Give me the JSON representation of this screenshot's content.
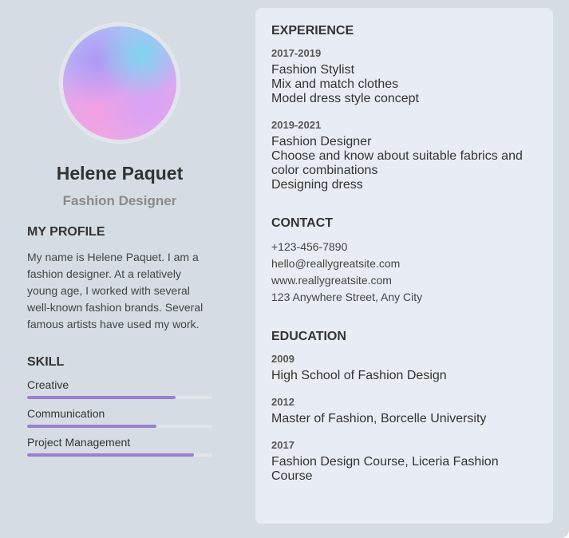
{
  "profile": {
    "name": "Helene Paquet",
    "role": "Fashion Designer"
  },
  "my_profile": {
    "title": "MY PROFILE",
    "text": "My name is Helene Paquet. I am a fashion designer. At a relatively young age, I worked with several well-known fashion brands. Several famous artists have used my work."
  },
  "skills": {
    "title": "SKILL",
    "items": [
      {
        "label": "Creative",
        "level": 0.8
      },
      {
        "label": "Communication",
        "level": 0.7
      },
      {
        "label": "Project Management",
        "level": 0.9
      }
    ]
  },
  "experience": {
    "title": "EXPERIENCE",
    "items": [
      {
        "years": "2017-2019",
        "position": "Fashion Stylist",
        "lines": [
          "Mix and match clothes",
          "Model dress style concept"
        ]
      },
      {
        "years": "2019-2021",
        "position": "Fashion Designer",
        "lines": [
          "Choose and know about suitable fabrics and color combinations",
          "Designing dress"
        ]
      }
    ]
  },
  "contact": {
    "title": "CONTACT",
    "phone": "+123-456-7890",
    "email": "hello@reallygreatsite.com",
    "website": "www.reallygreatsite.com",
    "address": "123 Anywhere Street, Any City"
  },
  "education": {
    "title": "EDUCATION",
    "items": [
      {
        "year": "2009",
        "school": "High School of Fashion Design"
      },
      {
        "year": "2012",
        "school": "Master of Fashion, Borcelle University"
      },
      {
        "year": "2017",
        "school": "Fashion Design Course, Liceria Fashion Course"
      }
    ]
  },
  "colors": {
    "page_bg": "#d6dce4",
    "panel_bg": "#e8edf5",
    "skill_fill": "#9b7fd0",
    "skill_track": "#e2e4e9"
  }
}
